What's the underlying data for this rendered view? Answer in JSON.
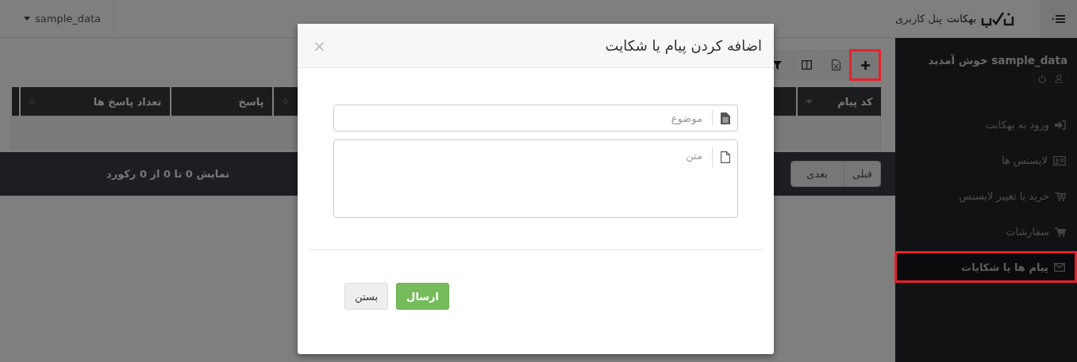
{
  "topbar": {
    "user_menu": "sample_data",
    "brand": "بهکانت",
    "subtitle": "پنل کاربری"
  },
  "sidebar": {
    "welcome": "sample_data خوش آمدید",
    "items": [
      {
        "label": "ورود به بهکانت",
        "kind": "login",
        "selected": false,
        "highlighted": false
      },
      {
        "label": "لایسنس ها",
        "kind": "card",
        "selected": false,
        "highlighted": false
      },
      {
        "label": "خرید یا تغییر لایسنس",
        "kind": "cart-plus",
        "selected": false,
        "highlighted": false
      },
      {
        "label": "سفارشات",
        "kind": "cart",
        "selected": false,
        "highlighted": false
      },
      {
        "label": "پیام ها یا شکایات",
        "kind": "envelope",
        "selected": true,
        "highlighted": true
      }
    ]
  },
  "toolbar": [
    {
      "kind": "add",
      "highlighted": true
    },
    {
      "kind": "excel",
      "highlighted": false
    },
    {
      "kind": "columns",
      "highlighted": false
    },
    {
      "kind": "filter",
      "highlighted": false
    }
  ],
  "table": {
    "columns": [
      {
        "label": "کد پیام",
        "kind": "sorted"
      },
      {
        "kind": "sortable"
      },
      {
        "label": "پاسخ",
        "kind": "plain"
      },
      {
        "label": "تعداد پاسخ ها",
        "kind": "sortable"
      },
      {
        "kind": "plain"
      }
    ],
    "info": "نمایش 0 تا 0 از 0 رکورد",
    "pager": [
      "قبلی",
      "بعدی"
    ]
  },
  "modal": {
    "title": "اضافه کردن پیام یا شکایت",
    "close": "×",
    "fields": [
      {
        "kind": "input",
        "placeholder": "موضوع"
      },
      {
        "kind": "textarea",
        "placeholder": "متن"
      }
    ],
    "buttons": [
      {
        "label": "ارسال",
        "kind": "primary"
      },
      {
        "label": "بستن",
        "kind": "default"
      }
    ]
  }
}
